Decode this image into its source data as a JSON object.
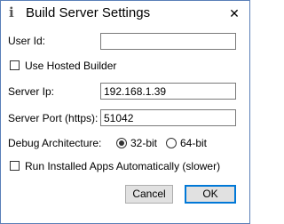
{
  "window": {
    "title": "Build Server Settings",
    "app_icon": "info-icon",
    "close_glyph": "✕"
  },
  "form": {
    "user_id_label": "User Id:",
    "user_id_value": "",
    "use_hosted_builder_label": "Use Hosted Builder",
    "use_hosted_builder_checked": false,
    "server_ip_label": "Server Ip:",
    "server_ip_value": "192.168.1.39",
    "server_port_label": "Server Port (https):",
    "server_port_value": "51042",
    "debug_arch_label": "Debug Architecture:",
    "arch_options": [
      {
        "label": "32-bit",
        "selected": true
      },
      {
        "label": "64-bit",
        "selected": false
      }
    ],
    "run_installed_label": "Run Installed Apps Automatically (slower)",
    "run_installed_checked": false
  },
  "buttons": {
    "cancel": "Cancel",
    "ok": "OK"
  },
  "colors": {
    "border": "#5a7fb8",
    "accent": "#0078d7",
    "button_face": "#e1e1e1"
  }
}
